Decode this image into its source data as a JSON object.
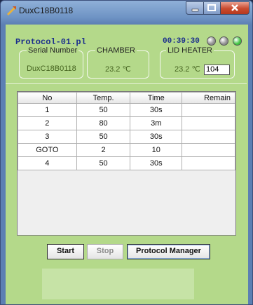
{
  "window": {
    "title": "DuxC18B0118"
  },
  "header": {
    "protocol_name": "Protocol-01.pl",
    "elapsed_time": "00:39:30",
    "indicators": [
      {
        "name": "status-led-1",
        "color": "#8f8f8f"
      },
      {
        "name": "status-led-2",
        "color": "#8f8f8f"
      },
      {
        "name": "status-led-3",
        "color": "#3fc43f"
      }
    ]
  },
  "groups": {
    "serial": {
      "label": "Serial Number",
      "value": "DuxC18B0118"
    },
    "chamber": {
      "label": "CHAMBER",
      "value": "23.2 ℃"
    },
    "lid_heater": {
      "label": "LID HEATER",
      "value": "23.2 ℃",
      "setpoint": "104"
    }
  },
  "table": {
    "headers": [
      "No",
      "Temp.",
      "Time",
      "Remain"
    ],
    "rows": [
      [
        "1",
        "50",
        "30s",
        ""
      ],
      [
        "2",
        "80",
        "3m",
        ""
      ],
      [
        "3",
        "50",
        "30s",
        ""
      ],
      [
        "GOTO",
        "2",
        "10",
        ""
      ],
      [
        "4",
        "50",
        "30s",
        ""
      ]
    ]
  },
  "buttons": {
    "start": "Start",
    "stop": "Stop",
    "protocol_manager": "Protocol Manager"
  },
  "colors": {
    "panel_green": "#b4d98a",
    "title_blue": "#1c2f8c",
    "close_red": "#c94a2e"
  }
}
